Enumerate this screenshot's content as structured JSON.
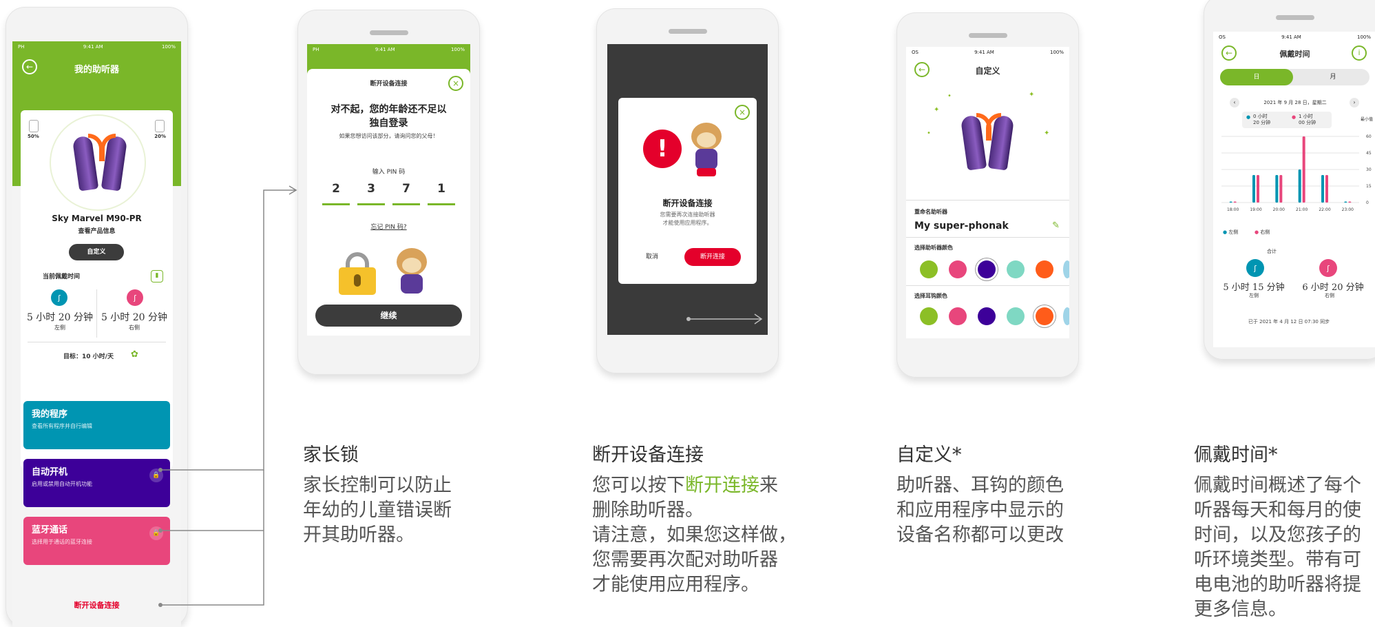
{
  "colors": {
    "brand_green": "#7ab729",
    "purple": "#3d0099",
    "teal": "#0095b2",
    "pink": "#e8467c",
    "red": "#e4002b",
    "dark": "#3c3c3c"
  },
  "phone1": {
    "status_left": "PH",
    "status_time": "9:41 AM",
    "status_right": "100%",
    "title": "我的助听器",
    "battery_left": "50%",
    "battery_right": "20%",
    "device_name": "Sky Marvel M90-PR",
    "product_info": "查看产品信息",
    "customize_button": "自定义",
    "wear_time_title": "当前佩戴时间",
    "left_time": "5 小时 20 分钟",
    "left_label": "左侧",
    "right_time": "5 小时 20 分钟",
    "right_label": "右侧",
    "goal_text": "目标：10 小时/天",
    "tiles": [
      {
        "title": "我的程序",
        "subtitle": "查看所有程序并自行编辑"
      },
      {
        "title": "自动开机",
        "subtitle": "启用或禁用自动开机功能"
      },
      {
        "title": "蓝牙通话",
        "subtitle": "选择用于通话的蓝牙连接"
      }
    ],
    "disconnect": "断开设备连接"
  },
  "phone2": {
    "status_left": "PH",
    "status_time": "9:41 AM",
    "status_right": "100%",
    "modal_title": "断开设备连接",
    "heading_line1": "对不起，您的年龄还不足以",
    "heading_line2": "独自登录",
    "sub": "如果您想访问该部分，请询问您的父母！",
    "pin_label": "输入 PIN 码",
    "pin": [
      "2",
      "3",
      "7",
      "1"
    ],
    "forgot": "忘记 PIN 码?",
    "continue": "继续"
  },
  "phone3": {
    "title": "断开设备连接",
    "text_line1": "您需要再次连接助听器",
    "text_line2": "才能使用应用程序。",
    "cancel": "取消",
    "disconnect": "断开连接"
  },
  "phone4": {
    "status_left": "OS",
    "status_time": "9:41 AM",
    "status_right": "100%",
    "title": "自定义",
    "rename_label": "重命名助听器",
    "device_name": "My super-phonak",
    "aid_color_label": "选择助听器颜色",
    "hook_color_label": "选择耳钩颜色",
    "swatches": [
      "#8cbf26",
      "#e8467c",
      "#3d0099",
      "#7fd8c3",
      "#ff5c1a",
      "#9fd4e8"
    ]
  },
  "phone5": {
    "status_left": "OS",
    "status_time": "9:41 AM",
    "status_right": "100%",
    "title": "佩戴时间",
    "tab_day": "日",
    "tab_month": "月",
    "date": "2021 年 9 月 28 日，星期二",
    "legend_left_value_1": "0 小时",
    "legend_left_value_2": "20 分钟",
    "legend_right_value_1": "1 小时",
    "legend_right_value_2": "00 分钟",
    "min_label": "最小值",
    "total_label": "合计",
    "legend_left": "左侧",
    "legend_right": "右侧",
    "left_total": "5 小时 15 分钟",
    "left_total_label": "左侧",
    "right_total": "6 小时 20 分钟",
    "right_total_label": "右侧",
    "sync": "已于 2021 年 4 月 12 日 07:30 同步"
  },
  "chart_data": {
    "type": "bar",
    "categories": [
      "18:00",
      "19:00",
      "20:00",
      "21:00",
      "22:00",
      "23:00"
    ],
    "yticks": [
      0,
      15,
      30,
      45,
      60
    ],
    "series": [
      {
        "name": "左侧",
        "color": "#0095b2",
        "values": [
          0,
          25,
          25,
          30,
          25,
          0
        ]
      },
      {
        "name": "右侧",
        "color": "#e8467c",
        "values": [
          0,
          25,
          25,
          60,
          25,
          0
        ]
      }
    ],
    "ylim": [
      0,
      60
    ]
  },
  "captions": [
    {
      "title": "家长锁",
      "body": [
        "家长控制可以防止",
        "年幼的儿童错误断",
        "开其助听器。"
      ]
    },
    {
      "title": "断开设备连接",
      "body_before": "您可以按下",
      "body_highlight": "断开连接",
      "body_after": "来",
      "body": [
        "删除助听器。",
        "请注意，如果您这样做，",
        "您需要再次配对助听器",
        "才能使用应用程序。"
      ]
    },
    {
      "title": "自定义*",
      "body": [
        "助听器、耳钩的颜色",
        "和应用程序中显示的",
        "设备名称都可以更改"
      ]
    },
    {
      "title": "佩戴时间*",
      "body": [
        "佩戴时间概述了每个",
        "听器每天和每月的使",
        "时间，以及您孩子的",
        "听环境类型。带有可",
        "电电池的助听器将提",
        "更多信息。"
      ]
    }
  ]
}
